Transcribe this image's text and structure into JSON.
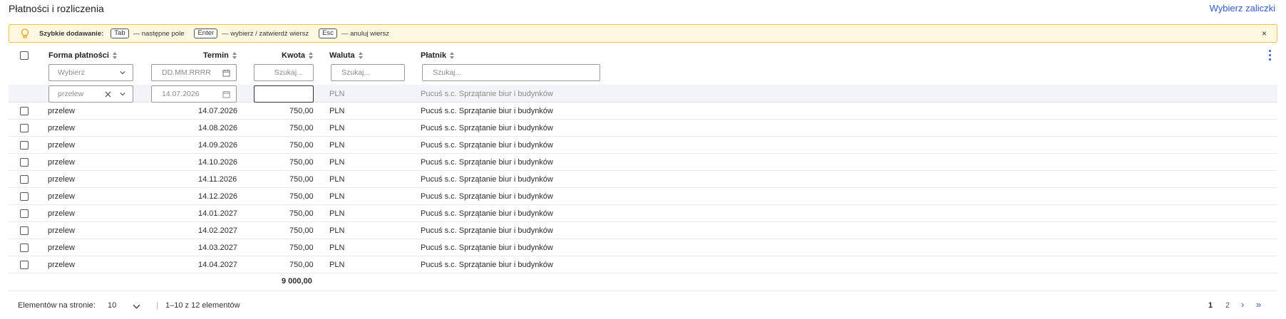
{
  "title": "Płatności i rozliczenia",
  "select_advances_link": "Wybierz zaliczki",
  "hint": {
    "label": "Szybkie dodawanie:",
    "items": [
      {
        "key": "Tab",
        "desc": "— następne pole"
      },
      {
        "key": "Enter",
        "desc": "— wybierz / zatwierdź wiersz"
      },
      {
        "key": "Esc",
        "desc": "— anuluj wiersz"
      }
    ],
    "close": "×"
  },
  "columns": {
    "form": "Forma płatności",
    "term": "Termin",
    "amount": "Kwota",
    "currency": "Waluta",
    "payer": "Płatnik"
  },
  "filters": {
    "form_placeholder": "Wybierz",
    "term_placeholder": "DD.MM.RRRR",
    "amount_placeholder": "Szukaj...",
    "currency_placeholder": "Szukaj...",
    "payer_placeholder": "Szukaj..."
  },
  "new_row": {
    "form": "przelew",
    "term_placeholder": "14.07.2026",
    "amount": "",
    "currency": "PLN",
    "payer": "Pucuś s.c. Sprzątanie biur i budynków"
  },
  "rows": [
    {
      "form": "przelew",
      "term": "14.07.2026",
      "amount": "750,00",
      "currency": "PLN",
      "payer": "Pucuś s.c. Sprzątanie biur i budynków"
    },
    {
      "form": "przelew",
      "term": "14.08.2026",
      "amount": "750,00",
      "currency": "PLN",
      "payer": "Pucuś s.c. Sprzątanie biur i budynków"
    },
    {
      "form": "przelew",
      "term": "14.09.2026",
      "amount": "750,00",
      "currency": "PLN",
      "payer": "Pucuś s.c. Sprzątanie biur i budynków"
    },
    {
      "form": "przelew",
      "term": "14.10.2026",
      "amount": "750,00",
      "currency": "PLN",
      "payer": "Pucuś s.c. Sprzątanie biur i budynków"
    },
    {
      "form": "przelew",
      "term": "14.11.2026",
      "amount": "750,00",
      "currency": "PLN",
      "payer": "Pucuś s.c. Sprzątanie biur i budynków"
    },
    {
      "form": "przelew",
      "term": "14.12.2026",
      "amount": "750,00",
      "currency": "PLN",
      "payer": "Pucuś s.c. Sprzątanie biur i budynków"
    },
    {
      "form": "przelew",
      "term": "14.01.2027",
      "amount": "750,00",
      "currency": "PLN",
      "payer": "Pucuś s.c. Sprzątanie biur i budynków"
    },
    {
      "form": "przelew",
      "term": "14.02.2027",
      "amount": "750,00",
      "currency": "PLN",
      "payer": "Pucuś s.c. Sprzątanie biur i budynków"
    },
    {
      "form": "przelew",
      "term": "14.03.2027",
      "amount": "750,00",
      "currency": "PLN",
      "payer": "Pucuś s.c. Sprzątanie biur i budynków"
    },
    {
      "form": "przelew",
      "term": "14.04.2027",
      "amount": "750,00",
      "currency": "PLN",
      "payer": "Pucuś s.c. Sprzątanie biur i budynków"
    }
  ],
  "total": "9 000,00",
  "pagination": {
    "per_page_label": "Elementów na stronie:",
    "per_page_value": "10",
    "range_text": "1–10 z 12 elementów",
    "pages": [
      "1",
      "2"
    ],
    "current_page": "1",
    "next": "›",
    "last": "»"
  },
  "colors": {
    "accent": "#3557c9",
    "hint_border": "#f3c047",
    "hint_bg": "#fff8e1",
    "new_row_bg": "#f3f4f8"
  }
}
